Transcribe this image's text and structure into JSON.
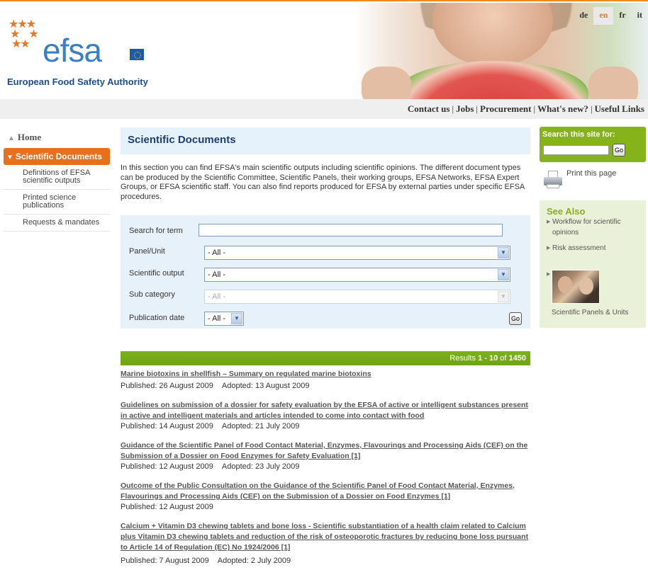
{
  "header": {
    "logo_word": "efsa",
    "logo_tagline": "European Food Safety Authority",
    "languages": [
      {
        "code": "de",
        "active": false
      },
      {
        "code": "en",
        "active": true
      },
      {
        "code": "fr",
        "active": false
      },
      {
        "code": "it",
        "active": false
      }
    ]
  },
  "top_links": [
    "Contact us",
    "Jobs",
    "Procurement",
    "What's new?",
    "Useful Links"
  ],
  "left_nav": {
    "home": "Home",
    "active": "Scientific Documents",
    "sub_items": [
      "Definitions of EFSA scientific outputs",
      "Printed science publications",
      "Requests & mandates"
    ]
  },
  "main": {
    "title": "Scientific Documents",
    "intro": "In this section you can find EFSA's main scientific outputs including scientific opinions. The different document types can be produced by the Scientific Committee, Scientific Panels, their working groups, EFSA Networks, EFSA Expert Groups, or EFSA scientific staff. You can also find reports produced for EFSA by external parties under specific EFSA procedures.",
    "search_form": {
      "term_label": "Search for term",
      "term_value": "",
      "panel_label": "Panel/Unit",
      "panel_value": "- All -",
      "output_label": "Scientific output",
      "output_value": "- All -",
      "subcat_label": "Sub category",
      "subcat_value": "- All -",
      "date_label": "Publication date",
      "date_value": "- All -",
      "go_label": "Go"
    },
    "results_bar": {
      "prefix": "Results",
      "range": "1 - 10",
      "of": "of",
      "total": "1450"
    },
    "results": [
      {
        "title": "Marine biotoxins in shellfish – Summary on regulated marine biotoxins",
        "published": "Published: 26 August 2009",
        "adopted": "Adopted: 13 August 2009"
      },
      {
        "title": "Guidelines on submission of a dossier for safety evaluation by the EFSA of active or intelligent substances present in active and intelligent materials and articles intended to come into contact with food",
        "published": "Published: 14 August 2009",
        "adopted": "Adopted: 21 July 2009"
      },
      {
        "title": "Guidance of the Scientific Panel of Food Contact Material, Enzymes, Flavourings and Processing Aids (CEF) on the Submission of a Dossier on Food Enzymes for Safety Evaluation [1]",
        "published": "Published: 12 August 2009",
        "adopted": "Adopted: 23 July 2009"
      },
      {
        "title": "Outcome of the Public Consultation on the Guidance of the Scientific Panel of Food Contact Material, Enzymes, Flavourings and Processing Aids (CEF) on the Submission of a Dossier on Food Enzymes [1]",
        "published": "Published: 12 August 2009",
        "adopted": ""
      },
      {
        "title": "Calcium + Vitamin D3 chewing tablets and bone loss - Scientific substantiation of a health claim related to Calcium plus Vitamin D3 chewing tablets and reduction of the risk of osteoporotic fractures by reducing bone loss pursuant to Article 14 of Regulation (EC) No 1924/2006 [1]",
        "published": "Published: 7 August 2009",
        "adopted": "Adopted: 2 July 2009"
      }
    ]
  },
  "right": {
    "search_label": "Search this site for:",
    "search_value": "",
    "go_label": "Go",
    "print_label": "Print this page",
    "see_also_title": "See Also",
    "see_also_links": [
      "Workflow for scientific opinions",
      "Risk assessment"
    ],
    "thumb_caption": "Scientific Panels & Units"
  },
  "colors": {
    "accent_orange": "#e6701e",
    "brand_blue": "#3a7fc4",
    "green": "#86b21a",
    "title_blue": "#1e3f6e"
  }
}
